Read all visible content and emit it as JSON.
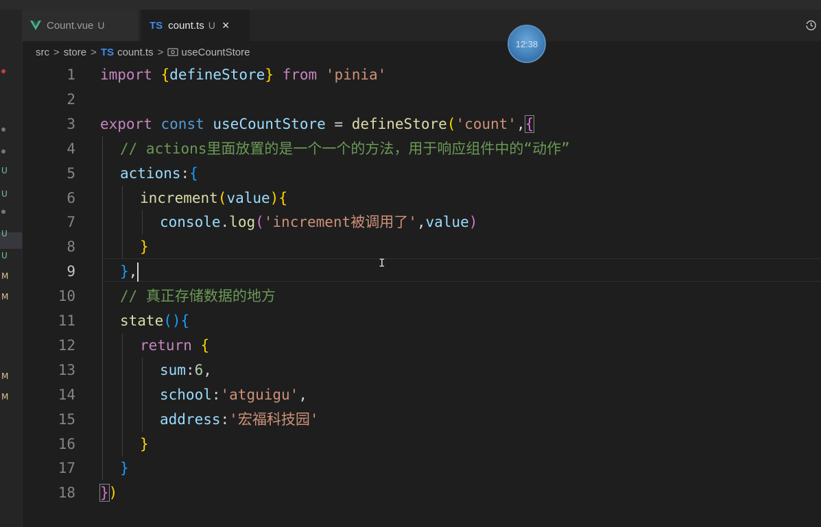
{
  "tabs": [
    {
      "label": "Count.vue",
      "status": "U",
      "icon": "vue-icon",
      "active": false
    },
    {
      "label": "count.ts",
      "status": "U",
      "icon": "ts-icon",
      "active": true,
      "close": "×"
    }
  ],
  "ts_badge": "TS",
  "breadcrumb": {
    "parts": [
      "src",
      "store",
      "count.ts",
      "useCountStore"
    ],
    "separator": ">",
    "ts_badge": "TS"
  },
  "clock": {
    "time": "12:38"
  },
  "git_markers": [
    "U",
    "U",
    "U",
    "U",
    "M",
    "M",
    "M",
    "M"
  ],
  "colors": {
    "background": "#1e1e1e",
    "keyword": "#c586c0",
    "storage": "#569cd6",
    "variable": "#9cdcfe",
    "function": "#dcdcaa",
    "string": "#ce9178",
    "comment": "#6a9955",
    "number": "#b5cea8"
  },
  "editor": {
    "active_line": "9",
    "lines": [
      {
        "n": "1",
        "indent": 0,
        "tokens": [
          [
            "kw",
            "import"
          ],
          [
            "punc",
            " "
          ],
          [
            "b1",
            "{"
          ],
          [
            "var",
            "defineStore"
          ],
          [
            "b1",
            "}"
          ],
          [
            "punc",
            " "
          ],
          [
            "kw",
            "from"
          ],
          [
            "punc",
            " "
          ],
          [
            "str",
            "'pinia'"
          ]
        ]
      },
      {
        "n": "2",
        "indent": 0,
        "tokens": []
      },
      {
        "n": "3",
        "indent": 0,
        "tokens": [
          [
            "kw",
            "export"
          ],
          [
            "punc",
            " "
          ],
          [
            "kw2",
            "const"
          ],
          [
            "punc",
            " "
          ],
          [
            "var",
            "useCountStore"
          ],
          [
            "punc",
            " = "
          ],
          [
            "fn",
            "defineStore"
          ],
          [
            "b1",
            "("
          ],
          [
            "str",
            "'count'"
          ],
          [
            "punc",
            ","
          ],
          [
            "b2box",
            "{"
          ]
        ]
      },
      {
        "n": "4",
        "indent": 1,
        "tokens": [
          [
            "cmt",
            "// actions里面放置的是一个一个的方法，用于响应组件中的“动作”"
          ]
        ]
      },
      {
        "n": "5",
        "indent": 1,
        "tokens": [
          [
            "var",
            "actions"
          ],
          [
            "punc",
            ":"
          ],
          [
            "b3",
            "{"
          ]
        ]
      },
      {
        "n": "6",
        "indent": 2,
        "tokens": [
          [
            "fn",
            "increment"
          ],
          [
            "b1",
            "("
          ],
          [
            "var",
            "value"
          ],
          [
            "b1",
            ")"
          ],
          [
            "b1",
            "{"
          ]
        ]
      },
      {
        "n": "7",
        "indent": 3,
        "tokens": [
          [
            "var",
            "console"
          ],
          [
            "punc",
            "."
          ],
          [
            "fn",
            "log"
          ],
          [
            "b2",
            "("
          ],
          [
            "str",
            "'increment被调用了'"
          ],
          [
            "punc",
            ","
          ],
          [
            "var",
            "value"
          ],
          [
            "b2",
            ")"
          ]
        ]
      },
      {
        "n": "8",
        "indent": 2,
        "tokens": [
          [
            "b1",
            "}"
          ]
        ]
      },
      {
        "n": "9",
        "indent": 1,
        "tokens": [
          [
            "b3",
            "}"
          ],
          [
            "punc",
            ","
          ]
        ],
        "cursor": true
      },
      {
        "n": "10",
        "indent": 1,
        "tokens": [
          [
            "cmt",
            "// 真正存储数据的地方"
          ]
        ]
      },
      {
        "n": "11",
        "indent": 1,
        "tokens": [
          [
            "fn",
            "state"
          ],
          [
            "b3",
            "()"
          ],
          [
            "b3",
            "{"
          ]
        ]
      },
      {
        "n": "12",
        "indent": 2,
        "tokens": [
          [
            "kw",
            "return"
          ],
          [
            "punc",
            " "
          ],
          [
            "b1",
            "{"
          ]
        ]
      },
      {
        "n": "13",
        "indent": 3,
        "tokens": [
          [
            "var",
            "sum"
          ],
          [
            "punc",
            ":"
          ],
          [
            "num",
            "6"
          ],
          [
            "punc",
            ","
          ]
        ]
      },
      {
        "n": "14",
        "indent": 3,
        "tokens": [
          [
            "var",
            "school"
          ],
          [
            "punc",
            ":"
          ],
          [
            "str",
            "'atguigu'"
          ],
          [
            "punc",
            ","
          ]
        ]
      },
      {
        "n": "15",
        "indent": 3,
        "tokens": [
          [
            "var",
            "address"
          ],
          [
            "punc",
            ":"
          ],
          [
            "str",
            "'宏福科技园'"
          ]
        ]
      },
      {
        "n": "16",
        "indent": 2,
        "tokens": [
          [
            "b1",
            "}"
          ]
        ]
      },
      {
        "n": "17",
        "indent": 1,
        "tokens": [
          [
            "b3",
            "}"
          ]
        ]
      },
      {
        "n": "18",
        "indent": 0,
        "tokens": [
          [
            "b2box",
            "}"
          ],
          [
            "b1",
            ")"
          ]
        ]
      }
    ]
  }
}
